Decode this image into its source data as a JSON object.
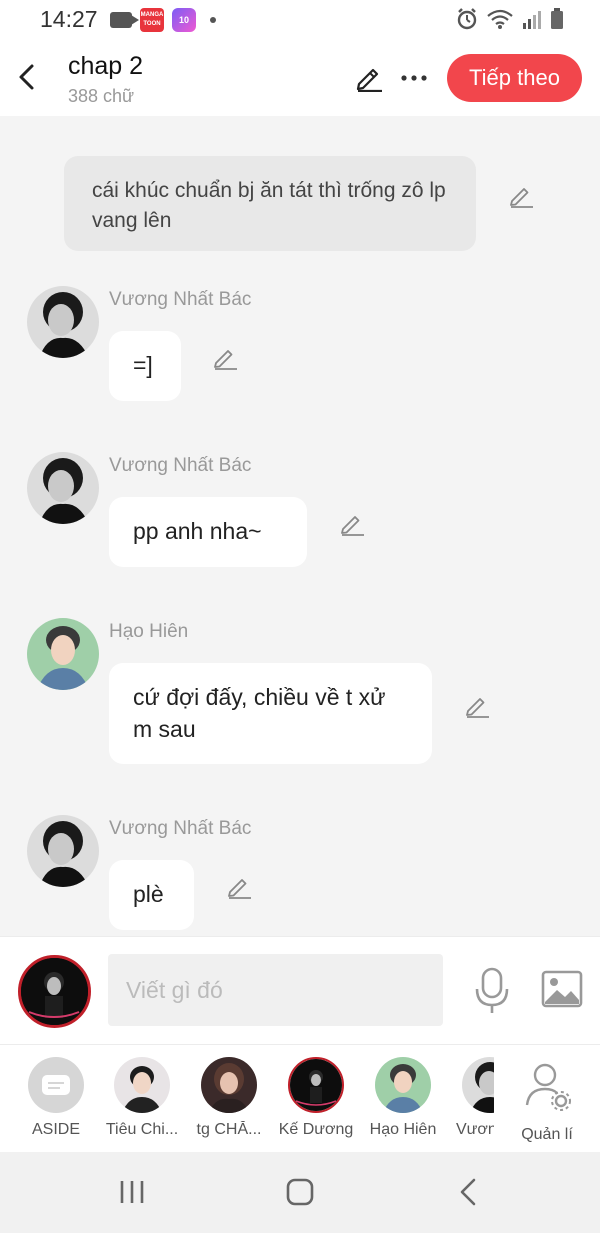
{
  "status_bar": {
    "time": "14:27",
    "manga_icon_text": "MANGA TOON",
    "app2_icon_text": "10"
  },
  "header": {
    "title": "chap 2",
    "word_count": "388 chữ",
    "next_label": "Tiếp theo"
  },
  "chat": {
    "aside_text": "cái khúc chuẩn bj ăn tát thì trống zô lp vang lên",
    "messages": [
      {
        "name": "Vương Nhất Bác",
        "text": "=]"
      },
      {
        "name": "Vương Nhất Bác",
        "text": "pp anh nha~"
      },
      {
        "name": "Hạo Hiên",
        "text": "cứ đợi đấy, chiều về t xử m sau"
      },
      {
        "name": "Vương Nhất Bác",
        "text": "plè"
      }
    ]
  },
  "input": {
    "placeholder": "Viết gì đó"
  },
  "characters": [
    {
      "label": "ASIDE"
    },
    {
      "label": "Tiêu Chi..."
    },
    {
      "label": "tg CHĂ..."
    },
    {
      "label": "Kế Dương"
    },
    {
      "label": "Hạo Hiên"
    },
    {
      "label": "Vươn"
    },
    {
      "label": "Quản lí"
    }
  ],
  "colors": {
    "accent": "#f2464c",
    "bubble": "#ffffff",
    "aside_bubble": "#e8e8e8",
    "background": "#f4f4f4"
  }
}
